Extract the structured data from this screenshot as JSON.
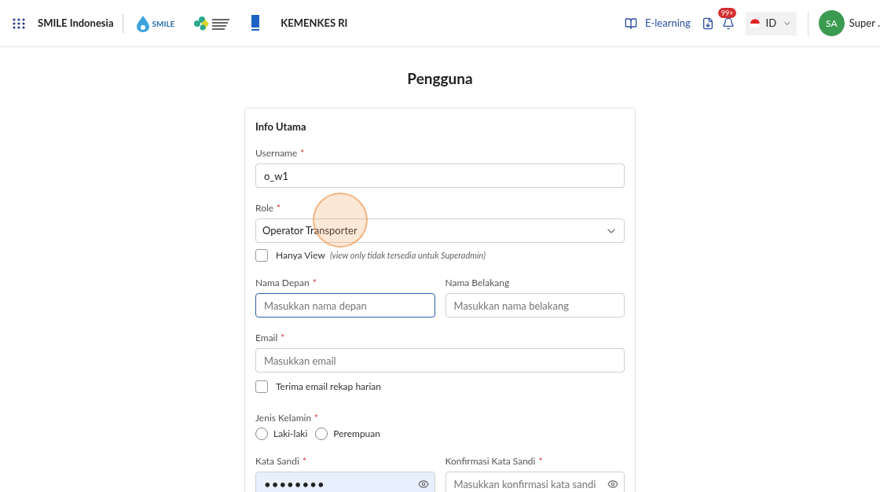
{
  "header": {
    "app_name": "SMILE Indonesia",
    "logo_text": "SMILE",
    "org_name": "KEMENKES RI",
    "elearning": "E-learning",
    "notification_badge": "99+",
    "language": "ID",
    "avatar_initials": "SA",
    "user_name": "Super ."
  },
  "page_title": "Pengguna",
  "card": {
    "title": "Info Utama",
    "username": {
      "label": "Username",
      "marker": "*",
      "value": "o_w1"
    },
    "role": {
      "label": "Role",
      "marker": "*",
      "value": "Operator Transporter"
    },
    "view_only": {
      "label": "Hanya View",
      "note": "(view only tidak tersedia untuk Superadmin)",
      "checked": false
    },
    "first_name": {
      "label": "Nama Depan",
      "marker": "*",
      "placeholder": "Masukkan nama depan",
      "focused": true
    },
    "last_name": {
      "label": "Nama Belakang",
      "placeholder": "Masukkan nama belakang",
      "focused": false
    },
    "email": {
      "label": "Email",
      "marker": "*",
      "placeholder": "Masukkan email"
    },
    "daily_email": {
      "label": "Terima email rekap harian",
      "checked": false
    },
    "gender": {
      "label": "Jenis Kelamin",
      "marker": "*",
      "options": [
        {
          "label": "Laki-laki",
          "selected": false
        },
        {
          "label": "Perempuan",
          "selected": false
        }
      ]
    },
    "password": {
      "label": "Kata Sandi",
      "marker": "*",
      "value": "••••••••",
      "autofilled": true
    },
    "confirm_password": {
      "label": "Konfirmasi Kata Sandi",
      "marker": "*",
      "placeholder": "Masukkan konfirmasi kata sandi",
      "autofilled": false
    }
  }
}
